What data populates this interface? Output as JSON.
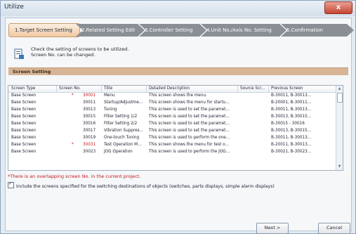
{
  "window": {
    "title": "Utilize",
    "close_glyph": "x"
  },
  "steps": [
    "1.Target Screen Setting",
    "2.Related Setting Edit",
    "3.Controller Setting",
    "4.Unit No./Axis No. Setting",
    "5.Confirmation"
  ],
  "info": {
    "line1": "Check the setting of screens to be utilized.",
    "line2": "Screen No. can be changed."
  },
  "section_title": "Screen Setting",
  "table": {
    "columns": [
      "Screen Type",
      "Screen No.",
      "Title",
      "Detailed Description",
      "Source Scr...",
      "Previous Screen"
    ],
    "rows": [
      {
        "type": "Base Screen",
        "mark": "*",
        "no": "30001",
        "title": "Menu",
        "desc": "This screen shows the menu.",
        "src": "",
        "prev": "B-30011, B-30013..."
      },
      {
        "type": "Base Screen",
        "mark": "",
        "no": "30011",
        "title": "Startup/Adjustme...",
        "desc": "This screen shows the menu for startu...",
        "src": "",
        "prev": "B-20001, B-30011..."
      },
      {
        "type": "Base Screen",
        "mark": "",
        "no": "30013",
        "title": "Tuning",
        "desc": "This screen is used to set the paramet...",
        "src": "",
        "prev": "B-30011, B-30013..."
      },
      {
        "type": "Base Screen",
        "mark": "",
        "no": "30015",
        "title": "Filter Setting 1/2",
        "desc": "This screen is used to set the paramet...",
        "src": "",
        "prev": "B-30013, B-30015..."
      },
      {
        "type": "Base Screen",
        "mark": "",
        "no": "30016",
        "title": "Filter Setting 2/2",
        "desc": "This screen is used to set the paramet...",
        "src": "",
        "prev": "B-30015 - 30016"
      },
      {
        "type": "Base Screen",
        "mark": "",
        "no": "30017",
        "title": "Vibration Suppres...",
        "desc": "This screen is used to set the paramet...",
        "src": "",
        "prev": "B-30013, B-30015..."
      },
      {
        "type": "Base Screen",
        "mark": "",
        "no": "30019",
        "title": "One-touch Tuning",
        "desc": "This screen is used to perform the one...",
        "src": "",
        "prev": "B-30011, B-30013..."
      },
      {
        "type": "Base Screen",
        "mark": "*",
        "no": "30031",
        "title": "Test Operation M...",
        "desc": "This screen shows the menu for test o...",
        "src": "",
        "prev": "B-20011, B-30013..."
      },
      {
        "type": "Base Screen",
        "mark": "",
        "no": "30023",
        "title": "JOG Operation",
        "desc": "This screen is used to perform the JOG...",
        "src": "",
        "prev": "B-30021, B-30023..."
      }
    ]
  },
  "note": "*There is an overlapping screen No. in the current project.",
  "checkbox_label": "Include the screens specified for the switching destinations of objects (switches, parts displays, simple alarm displays)",
  "buttons": {
    "next": "Next >",
    "cancel": "Cancel"
  },
  "colors": {
    "accent_red": "#c4161c",
    "step_active": "#f2c9a2",
    "step_inactive": "#8a8f95",
    "section_bg": "#d7b495"
  }
}
